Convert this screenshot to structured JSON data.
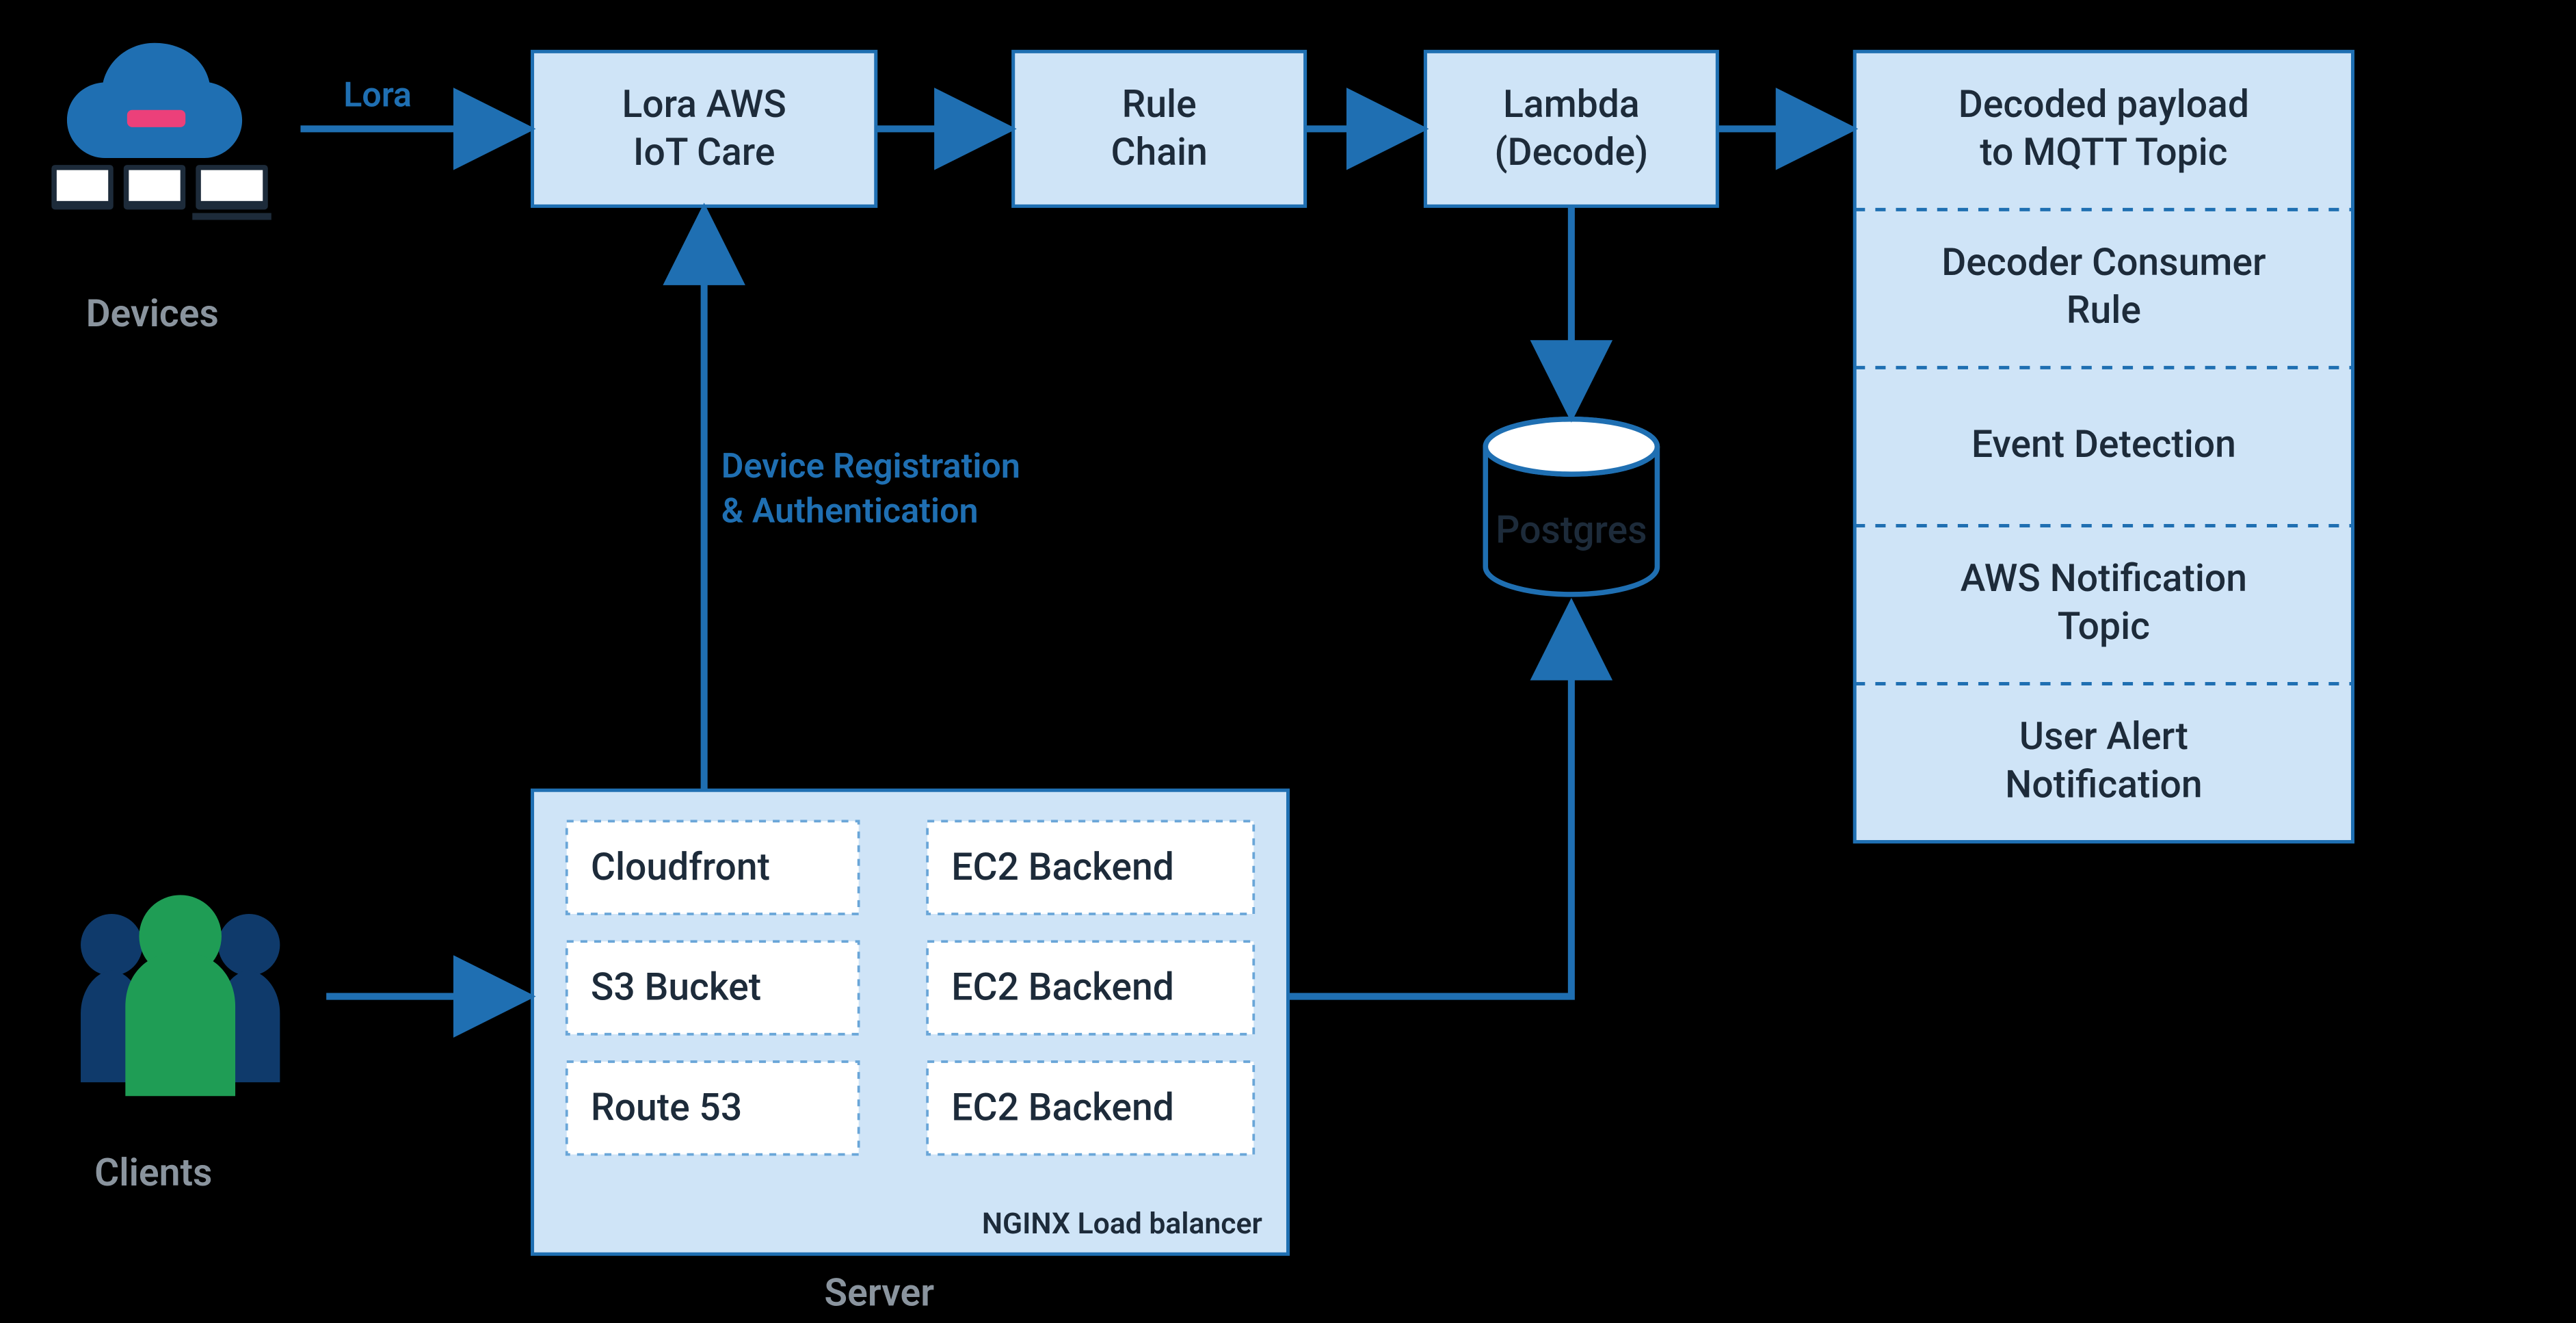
{
  "groups": {
    "devices": "Devices",
    "clients": "Clients",
    "server": "Server"
  },
  "nodes": {
    "iot_care_l1": "Lora AWS",
    "iot_care_l2": "IoT Care",
    "rule_chain_l1": "Rule",
    "rule_chain_l2": "Chain",
    "lambda_l1": "Lambda",
    "lambda_l2": "(Decode)",
    "postgres": "Postgres"
  },
  "server_box": {
    "cloudfront": "Cloudfront",
    "s3": "S3 Bucket",
    "route53": "Route 53",
    "ec2_1": "EC2 Backend",
    "ec2_2": "EC2 Backend",
    "ec2_3": "EC2 Backend",
    "nginx": "NGINX Load balancer"
  },
  "stack": {
    "s1_l1": "Decoded payload",
    "s1_l2": "to MQTT Topic",
    "s2_l1": "Decoder Consumer",
    "s2_l2": "Rule",
    "s3": "Event Detection",
    "s4_l1": "AWS Notification",
    "s4_l2": "Topic",
    "s5_l1": "User Alert",
    "s5_l2": "Notification"
  },
  "edges": {
    "lora": "Lora",
    "devreg_l1": "Device Registration",
    "devreg_l2": "& Authentication"
  }
}
